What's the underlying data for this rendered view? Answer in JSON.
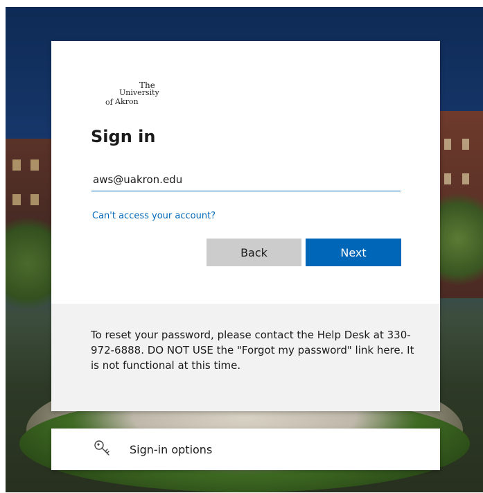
{
  "logo": {
    "line1": "The",
    "line2": "University",
    "line3": "of",
    "line4": "Akron"
  },
  "signin": {
    "title": "Sign in",
    "email_value": "aws@uakron.edu",
    "cant_access_label": "Can't access your account?",
    "back_label": "Back",
    "next_label": "Next"
  },
  "notice": {
    "text": "To reset your password, please contact the Help Desk at 330-972-6888. DO NOT USE the \"Forgot my password\" link here. It is not functional at this time."
  },
  "options": {
    "label": "Sign-in options",
    "icon": "key-icon"
  },
  "colors": {
    "accent": "#0067b8",
    "back_button": "#cccccc",
    "notice_bg": "#f2f2f2"
  }
}
